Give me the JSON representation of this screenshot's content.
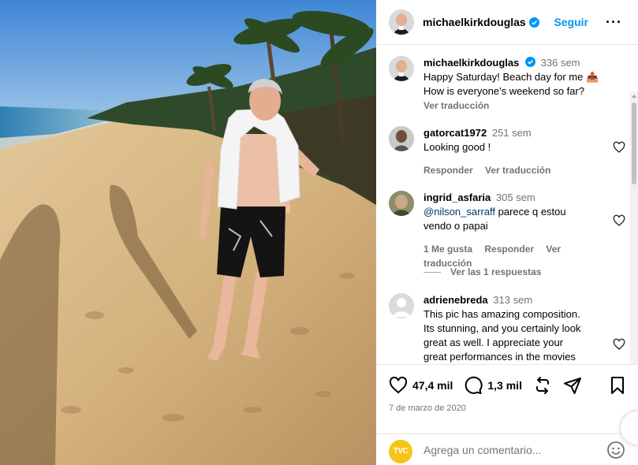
{
  "post": {
    "username": "michaelkirkdouglas",
    "follow_label": "Seguir",
    "more_label": "···",
    "caption": {
      "username": "michaelkirkdouglas",
      "time": "336 sem",
      "text_line1": "Happy Saturday! Beach day for me 📤",
      "text_line2": "How is everyone's weekend so far?",
      "translate": "Ver traducción"
    }
  },
  "comments": [
    {
      "username": "gatorcat1972",
      "time": "251 sem",
      "text": "Looking good !",
      "reply": "Responder",
      "translate": "Ver traducción"
    },
    {
      "username": "ingrid_asfaria",
      "time": "305 sem",
      "mention": "@nilson_sarraff",
      "text_line1": " parece q estou",
      "text_line2": "vendo o papai",
      "likes": "1 Me gusta",
      "reply": "Responder",
      "translate": "Ver traducción",
      "view_replies": "Ver las 1 respuestas"
    },
    {
      "username": "adrienebreda",
      "time": "313 sem",
      "text_lines": [
        "This pic has amazing composition.",
        "Its stunning, and you certainly look",
        "great as well. I appreciate your",
        "great performances in the movies"
      ]
    }
  ],
  "actions": {
    "likes_count": "47,4 mil",
    "comments_count": "1,3 mil",
    "date": "7 de marzo de 2020"
  },
  "add_comment": {
    "placeholder": "Agrega un comentario...",
    "avatar_text": "TVC"
  },
  "colors": {
    "accent": "#0095f6",
    "verified": "#0095f6",
    "muted": "#737373"
  }
}
